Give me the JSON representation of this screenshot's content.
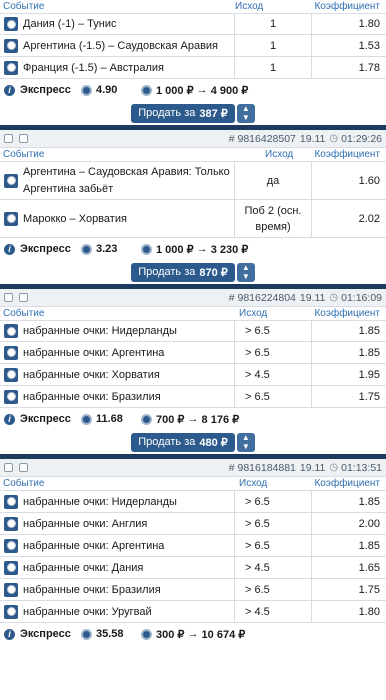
{
  "headers": {
    "event": "Событие",
    "outcome": "Исход",
    "coeff": "Коэффициент"
  },
  "express_label": "Экспресс",
  "sell_prefix": "Продать за",
  "cards": [
    {
      "number": "",
      "date": "",
      "time": "",
      "rows": [
        {
          "event": "Дания (-1) – Тунис",
          "outcome": "1",
          "coeff": "1.80"
        },
        {
          "event": "Аргентина (-1.5) – Саудовская Аравия",
          "outcome": "1",
          "coeff": "1.53"
        },
        {
          "event": "Франция (-1.5) – Австралия",
          "outcome": "1",
          "coeff": "1.78"
        }
      ],
      "total_coeff": "4.90",
      "stake": "1 000 ₽",
      "arrow": "→",
      "payout": "4 900 ₽",
      "sell_amount": "387 ₽"
    },
    {
      "number": "# 9816428507",
      "date": "19.11",
      "time": "01:29:26",
      "rows": [
        {
          "event": "Аргентина – Саудовская Аравия: Только Аргентина забьёт",
          "outcome": "да",
          "coeff": "1.60"
        },
        {
          "event": "Марокко – Хорватия",
          "outcome": "Поб 2 (осн. время)",
          "coeff": "2.02"
        }
      ],
      "total_coeff": "3.23",
      "stake": "1 000 ₽",
      "arrow": "→",
      "payout": "3 230 ₽",
      "sell_amount": "870 ₽"
    },
    {
      "number": "# 9816224804",
      "date": "19.11",
      "time": "01:16:09",
      "rows": [
        {
          "event": "набранные очки: Нидерланды",
          "outcome": "> 6.5",
          "coeff": "1.85"
        },
        {
          "event": "набранные очки: Аргентина",
          "outcome": "> 6.5",
          "coeff": "1.85"
        },
        {
          "event": "набранные очки: Хорватия",
          "outcome": "> 4.5",
          "coeff": "1.95"
        },
        {
          "event": "набранные очки: Бразилия",
          "outcome": "> 6.5",
          "coeff": "1.75"
        }
      ],
      "total_coeff": "11.68",
      "stake": "700 ₽",
      "arrow": "→",
      "payout": "8 176 ₽",
      "sell_amount": "480 ₽"
    },
    {
      "number": "# 9816184881",
      "date": "19.11",
      "time": "01:13:51",
      "rows": [
        {
          "event": "набранные очки: Нидерланды",
          "outcome": "> 6.5",
          "coeff": "1.85"
        },
        {
          "event": "набранные очки: Англия",
          "outcome": "> 6.5",
          "coeff": "2.00"
        },
        {
          "event": "набранные очки: Аргентина",
          "outcome": "> 6.5",
          "coeff": "1.85"
        },
        {
          "event": "набранные очки: Дания",
          "outcome": "> 4.5",
          "coeff": "1.65"
        },
        {
          "event": "набранные очки: Бразилия",
          "outcome": "> 6.5",
          "coeff": "1.75"
        },
        {
          "event": "набранные очки: Уругвай",
          "outcome": "> 4.5",
          "coeff": "1.80"
        }
      ],
      "total_coeff": "35.58",
      "stake": "300 ₽",
      "arrow": "→",
      "payout": "10 674 ₽",
      "sell_amount": ""
    }
  ]
}
